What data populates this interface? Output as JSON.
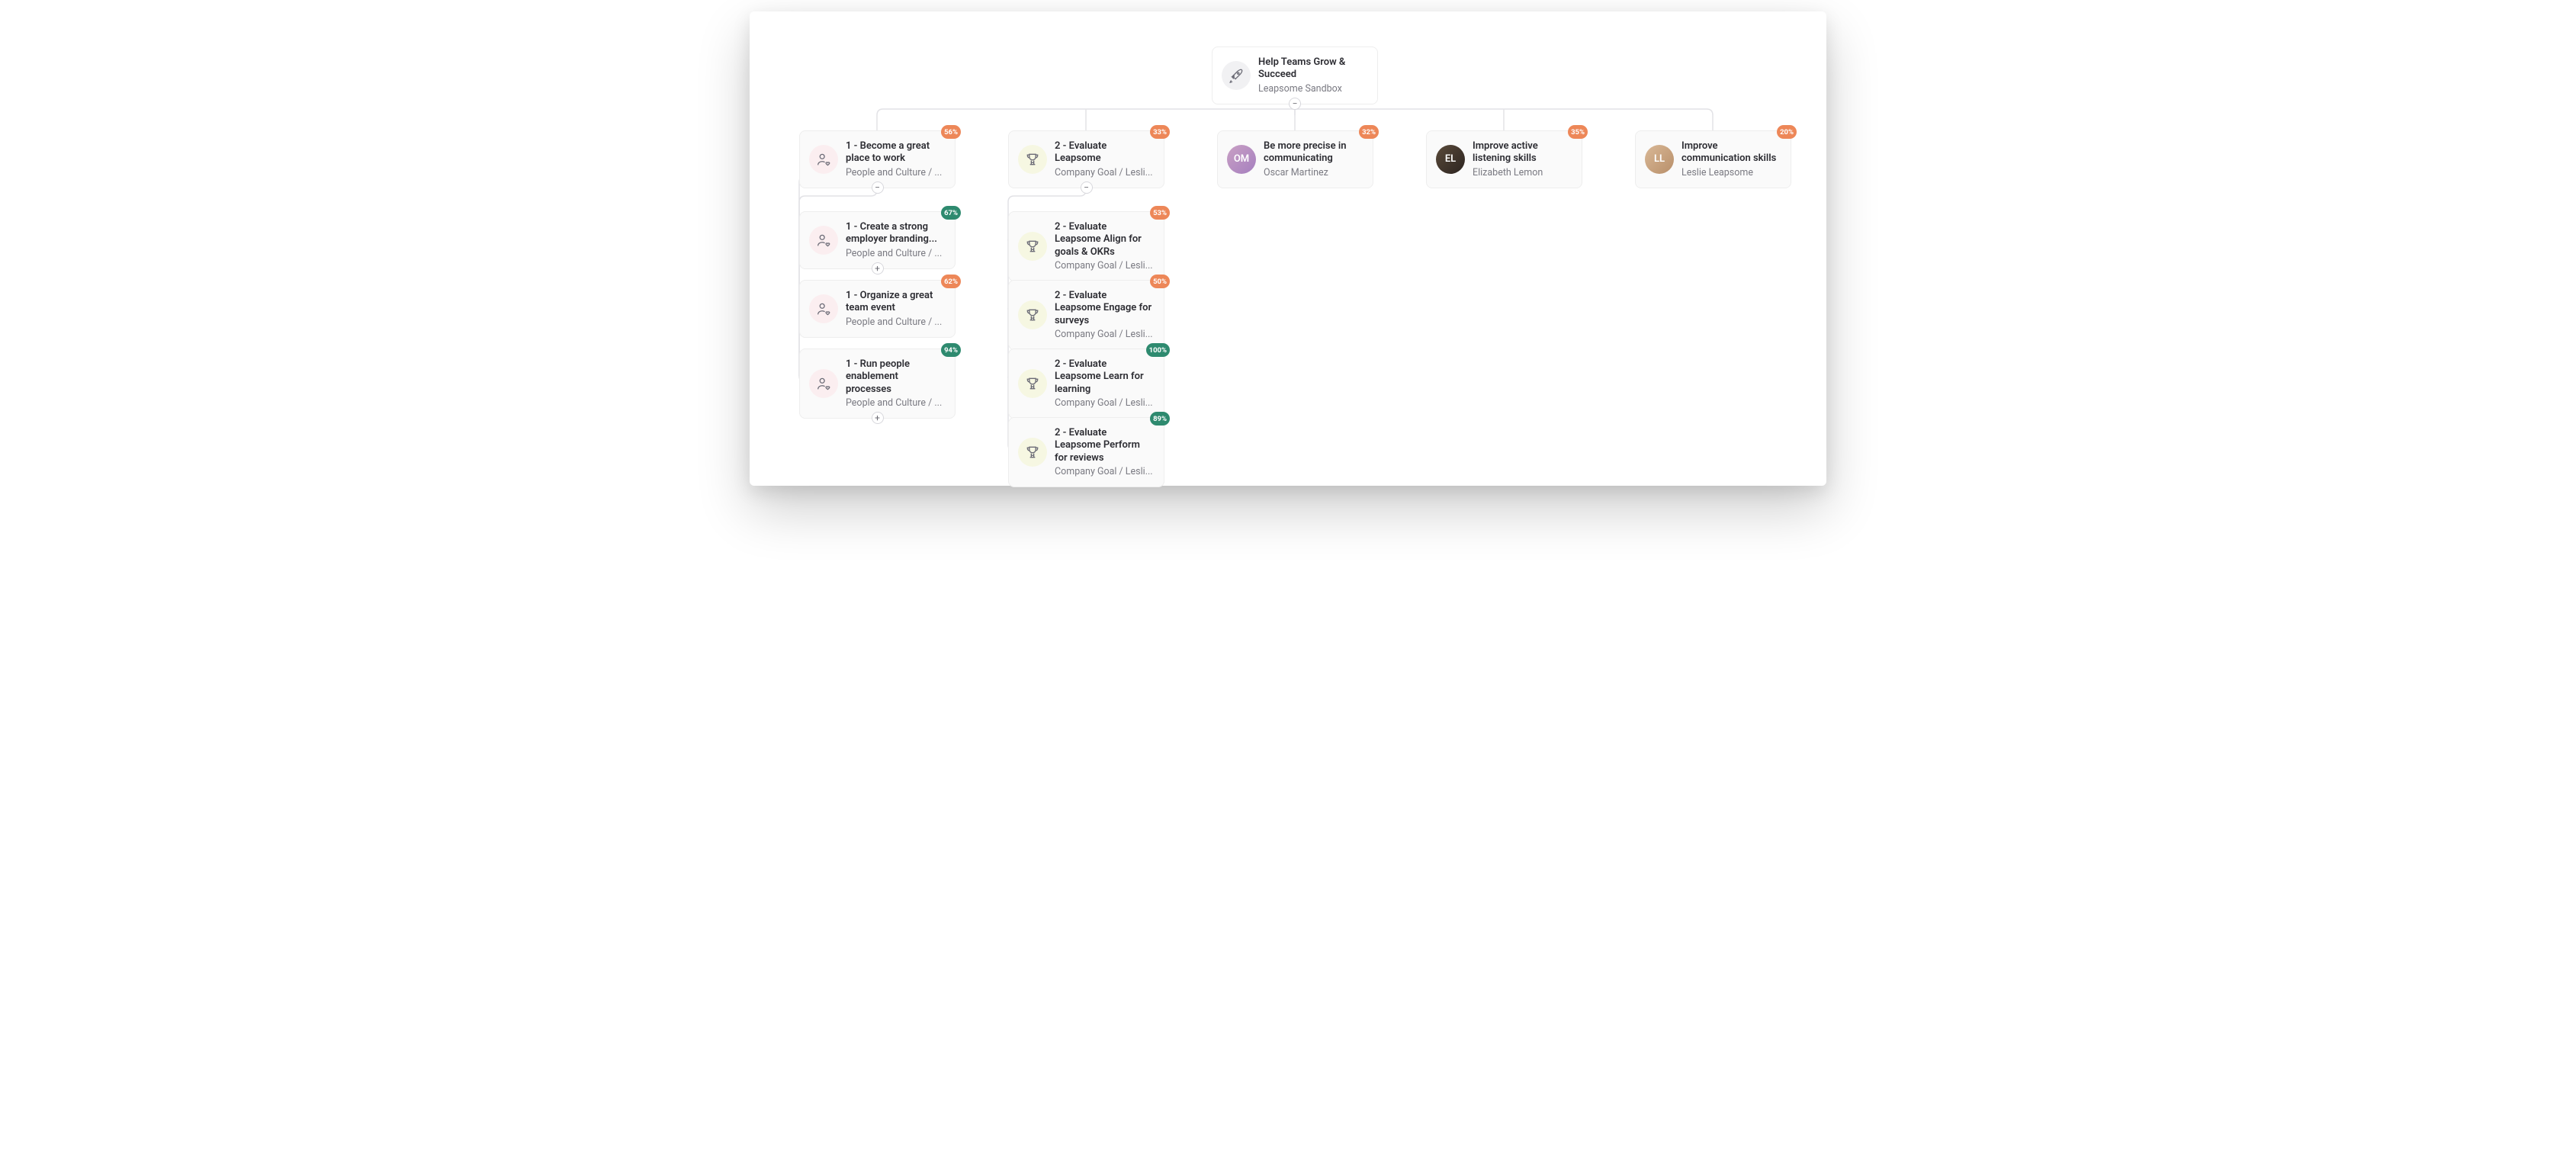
{
  "root": {
    "title": "Help Teams Grow & Succeed",
    "subtitle": "Leapsome Sandbox",
    "toggle": "−"
  },
  "level1": {
    "col0": {
      "title": "1 - Become a great place to work",
      "subtitle": "People and Culture / ...",
      "badge": "56%",
      "badgeColor": "orange",
      "toggle": "−"
    },
    "col1": {
      "title": "2 - Evaluate Leapsome",
      "subtitle": "Company Goal / Lesli...",
      "badge": "33%",
      "badgeColor": "orange",
      "toggle": "−"
    },
    "col2": {
      "title": "Be more precise in communicating",
      "subtitle": "Oscar Martinez",
      "badge": "32%",
      "badgeColor": "orange"
    },
    "col3": {
      "title": "Improve active listening skills",
      "subtitle": "Elizabeth Lemon",
      "badge": "35%",
      "badgeColor": "orange"
    },
    "col4": {
      "title": "Improve communication skills",
      "subtitle": "Leslie Leapsome",
      "badge": "20%",
      "badgeColor": "orange"
    }
  },
  "col0children": [
    {
      "title": "1 - Create a strong employer branding...",
      "subtitle": "People and Culture / ...",
      "badge": "67%",
      "badgeColor": "green",
      "toggle": "+"
    },
    {
      "title": "1 - Organize a great team event",
      "subtitle": "People and Culture / ...",
      "badge": "62%",
      "badgeColor": "orange"
    },
    {
      "title": "1 - Run people enablement processes",
      "subtitle": "People and Culture / ...",
      "badge": "94%",
      "badgeColor": "green",
      "toggle": "+"
    }
  ],
  "col1children": [
    {
      "title": "2 - Evaluate Leapsome Align for goals & OKRs",
      "subtitle": "Company Goal / Lesli...",
      "badge": "53%",
      "badgeColor": "orange"
    },
    {
      "title": "2 - Evaluate Leapsome Engage for surveys",
      "subtitle": "Company Goal / Lesli...",
      "badge": "50%",
      "badgeColor": "orange"
    },
    {
      "title": "2 - Evaluate Leapsome Learn for learning",
      "subtitle": "Company Goal / Lesli...",
      "badge": "100%",
      "badgeColor": "green"
    },
    {
      "title": "2 - Evaluate Leapsome Perform for reviews",
      "subtitle": "Company Goal / Lesli...",
      "badge": "89%",
      "badgeColor": "green"
    }
  ]
}
